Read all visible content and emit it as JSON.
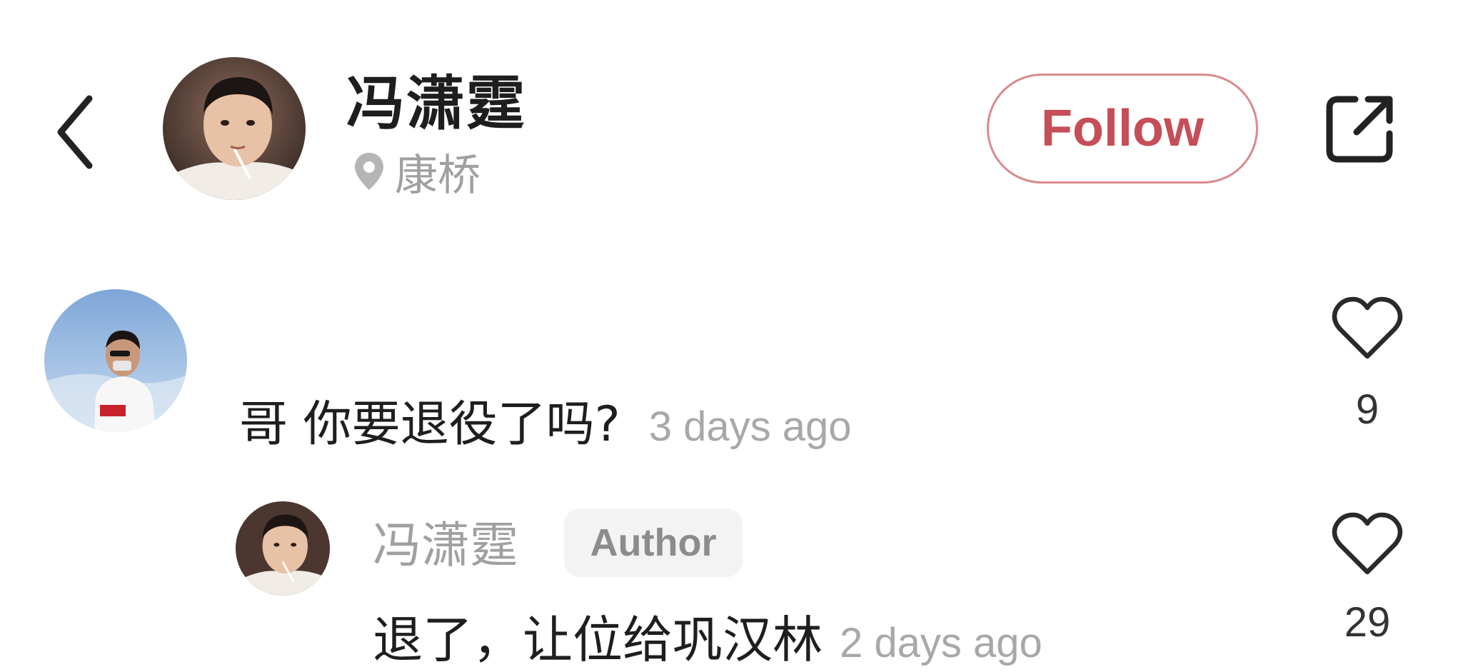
{
  "header": {
    "name": "冯潇霆",
    "location": "康桥",
    "follow_label": "Follow",
    "icons": {
      "back": "chevron-left-icon",
      "location": "location-pin-icon",
      "share": "share-external-icon"
    }
  },
  "comments": [
    {
      "text": "哥 你要退役了吗?",
      "time": "3 days ago",
      "likes": "9",
      "replies": [
        {
          "name": "冯潇霆",
          "badge": "Author",
          "text": "退了，让位给巩汉林",
          "time": "2 days ago",
          "likes": "29"
        }
      ]
    }
  ],
  "colors": {
    "accent": "#c54e58",
    "follow_border": "#d98a8f",
    "muted_text": "#a0a0a0",
    "badge_bg": "#f3f3f3"
  }
}
